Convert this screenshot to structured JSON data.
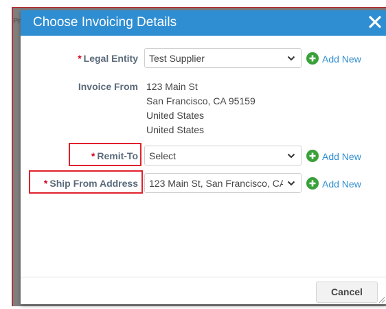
{
  "backdrop": {
    "fragment": "Pr"
  },
  "dialog": {
    "title": "Choose Invoicing Details",
    "close_icon": "close-icon"
  },
  "fields": {
    "legal_entity": {
      "required_mark": "*",
      "label": "Legal Entity",
      "value": "Test Supplier",
      "add_new": "Add New"
    },
    "invoice_from": {
      "label": "Invoice From",
      "lines": [
        "123 Main St",
        "San Francisco, CA 95159",
        "United States",
        "United States"
      ]
    },
    "remit_to": {
      "required_mark": "*",
      "label": "Remit-To",
      "value": "Select",
      "add_new": "Add New"
    },
    "ship_from": {
      "required_mark": "*",
      "label": "Ship From Address",
      "value": "123 Main St, San Francisco, CA",
      "add_new": "Add New"
    }
  },
  "footer": {
    "cancel_label": "Cancel"
  },
  "colors": {
    "header": "#2f8ed2",
    "required": "#d0021b",
    "highlight": "#e0202c",
    "add_icon": "#3aa13a",
    "link": "#2f8ed2"
  }
}
